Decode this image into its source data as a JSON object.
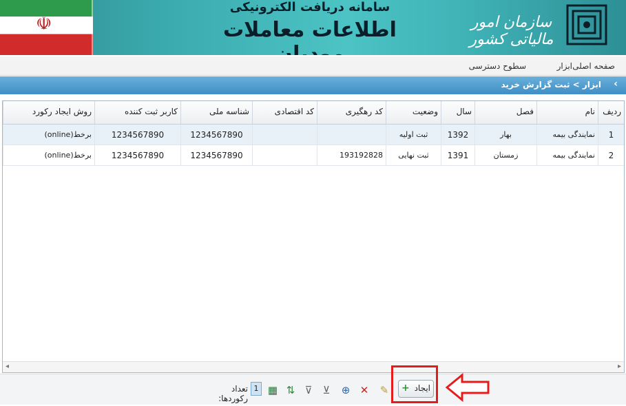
{
  "header": {
    "subtitle": "سامانه دریافت الکترونیکی",
    "title": "اطلاعات معاملات مودیان",
    "org_name": "سازمان امور مالیاتی کشور"
  },
  "menu": {
    "items": [
      {
        "label": "صفحه اصلی"
      },
      {
        "label": "ابزار"
      },
      {
        "label": "سطوح دسترسی"
      }
    ]
  },
  "breadcrumb": {
    "text": "ابزار > ثبت گزارش خرید"
  },
  "grid": {
    "columns": [
      "ردیف",
      "نام",
      "فصل",
      "سال",
      "وضعیت",
      "کد رهگیری",
      "کد اقتصادی",
      "شناسه ملی",
      "کاربر ثبت کننده",
      "روش ایجاد رکورد"
    ],
    "rows": [
      {
        "row": "1",
        "name": "نمایندگی بیمه",
        "season": "بهار",
        "year": "1392",
        "status": "ثبت اولیه",
        "tracking": "",
        "economic": "",
        "national": "1234567890",
        "user": "1234567890",
        "method": "برخط(online)"
      },
      {
        "row": "2",
        "name": "نمایندگی بیمه",
        "season": "زمستان",
        "year": "1391",
        "status": "ثبت نهایی",
        "tracking": "193192828",
        "economic": "",
        "national": "1234567890",
        "user": "1234567890",
        "method": "برخط(online)"
      }
    ]
  },
  "toolbar": {
    "create_label": "ایجاد",
    "record_count_label": "تعداد رکوردها:",
    "record_count": "1"
  },
  "colors": {
    "banner": "#3aa9ad",
    "breadcrumb": "#3f8ec6",
    "highlight": "#e51c1c"
  }
}
